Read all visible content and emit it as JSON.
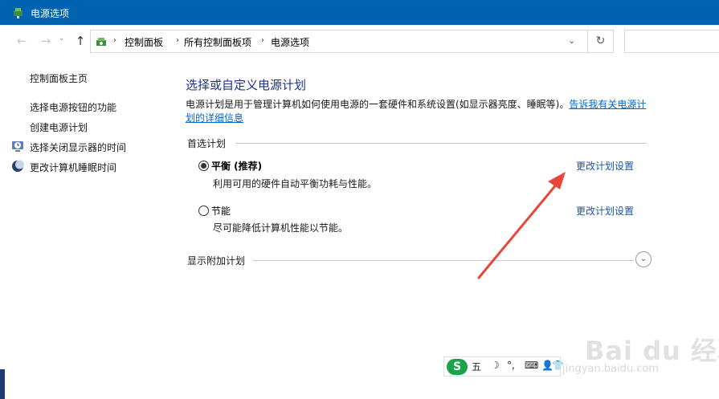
{
  "window": {
    "title": "电源选项"
  },
  "nav": {
    "back_icon": "back-arrow-icon",
    "forward_icon": "forward-arrow-icon",
    "up_icon": "up-arrow-icon",
    "breadcrumbs": [
      "控制面板",
      "所有控制面板项",
      "电源选项"
    ],
    "refresh_icon": "refresh-icon"
  },
  "sidebar": {
    "home": "控制面板主页",
    "items": [
      {
        "label": "选择电源按钮的功能",
        "icon": ""
      },
      {
        "label": "创建电源计划",
        "icon": ""
      },
      {
        "label": "选择关闭显示器的时间",
        "icon": "monitor-clock-icon"
      },
      {
        "label": "更改计算机睡眠时间",
        "icon": "moon-icon"
      }
    ]
  },
  "main": {
    "title": "选择或自定义电源计划",
    "description": "电源计划是用于管理计算机如何使用电源的一套硬件和系统设置(如显示器亮度、睡眠等)。",
    "description_link": "告诉我有关电源计划的详细信息",
    "preferred_label": "首选计划",
    "plans": [
      {
        "name": "平衡 (推荐)",
        "desc": "利用可用的硬件自动平衡功耗与性能。",
        "link": "更改计划设置",
        "selected": true
      },
      {
        "name": "节能",
        "desc": "尽可能降低计算机性能以节能。",
        "link": "更改计划设置",
        "selected": false
      }
    ],
    "show_more_label": "显示附加计划"
  },
  "ime": {
    "logo": "S",
    "mode": "五",
    "items": [
      "☽",
      "°,",
      "⌨",
      "👤",
      "👕"
    ]
  },
  "watermark": {
    "brand": "Bai du 经验",
    "url": "jingyan.baidu.com"
  },
  "colors": {
    "titlebar": "#0063b1",
    "heading": "#1e3287",
    "link": "#1a56a8",
    "arrow": "#e8463c"
  }
}
